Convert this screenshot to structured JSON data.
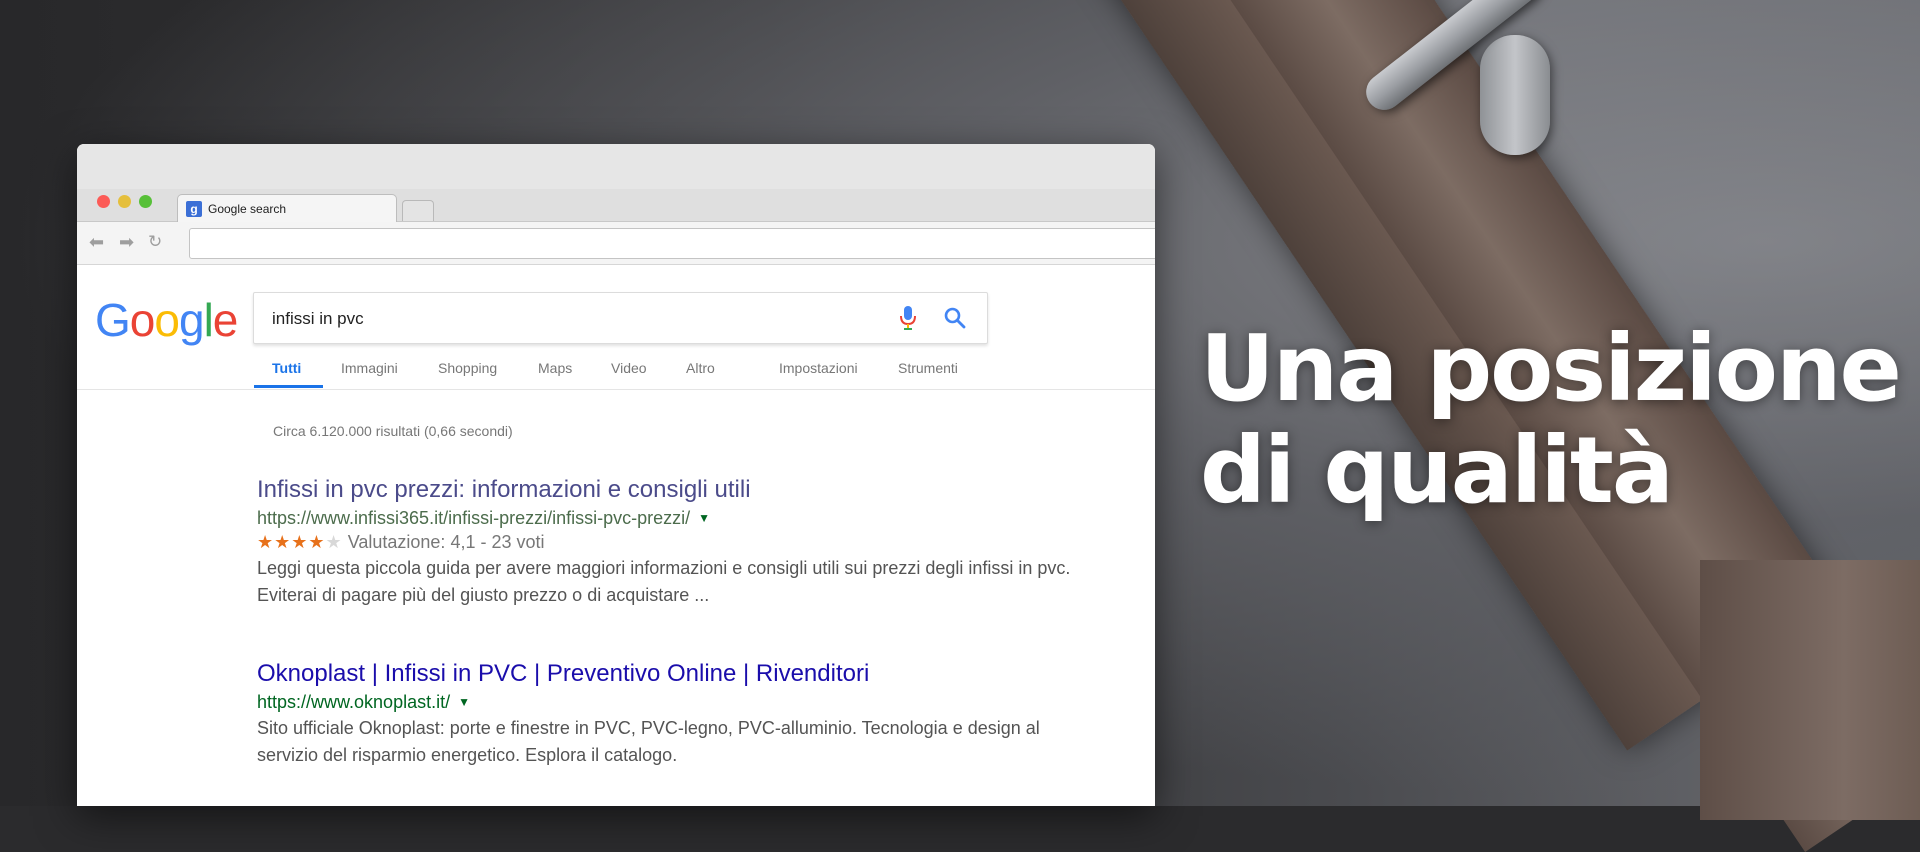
{
  "headline": {
    "line1": "Una posizione",
    "line2": "di qualità"
  },
  "browser": {
    "tab_title": "Google search",
    "favicon_letter": "g",
    "url": ""
  },
  "google": {
    "logo": [
      "G",
      "o",
      "o",
      "g",
      "l",
      "e"
    ],
    "query": "infissi in pvc",
    "tabs": [
      "Tutti",
      "Immagini",
      "Shopping",
      "Maps",
      "Video",
      "Altro",
      "Impostazioni",
      "Strumenti"
    ],
    "active_tab": "Tutti",
    "stats": "Circa 6.120.000 risultati (0,66 secondi)"
  },
  "results": [
    {
      "title": "Infissi in pvc prezzi: informazioni e consigli utili",
      "url": "https://www.infissi365.it/infissi-prezzi/infissi-pvc-prezzi/",
      "stars_filled": "★★★★",
      "stars_empty": "★",
      "rating_text": "Valutazione: 4,1 - 23 voti",
      "rating_value": 4.1,
      "snippet_line1": "Leggi questa piccola guida per avere maggiori informazioni e consigli utili sui prezzi degli infissi in pvc.",
      "snippet_line2": "Eviterai di pagare più del giusto prezzo o di acquistare ..."
    },
    {
      "title": "Oknoplast | Infissi in PVC | Preventivo Online | Rivenditori",
      "url": "https://www.oknoplast.it/",
      "snippet_line1": "Sito ufficiale Oknoplast: porte e finestre in PVC, PVC-legno, PVC-alluminio. Tecnologia e design al",
      "snippet_line2": "servizio del risparmio energetico. Esplora il catalogo."
    }
  ],
  "colors": {
    "link": "#1a0dab",
    "link_visited": "#4b4b8a",
    "url_green": "#006621",
    "google_blue": "#4285f4",
    "google_red": "#ea4335",
    "google_yellow": "#fbbc05",
    "google_green": "#34a853",
    "star": "#e7711b"
  },
  "icons": {
    "back": "arrow-left-icon",
    "forward": "arrow-right-icon",
    "reload": "reload-icon",
    "mic": "microphone-icon",
    "search": "search-icon",
    "caret": "caret-down-icon"
  }
}
